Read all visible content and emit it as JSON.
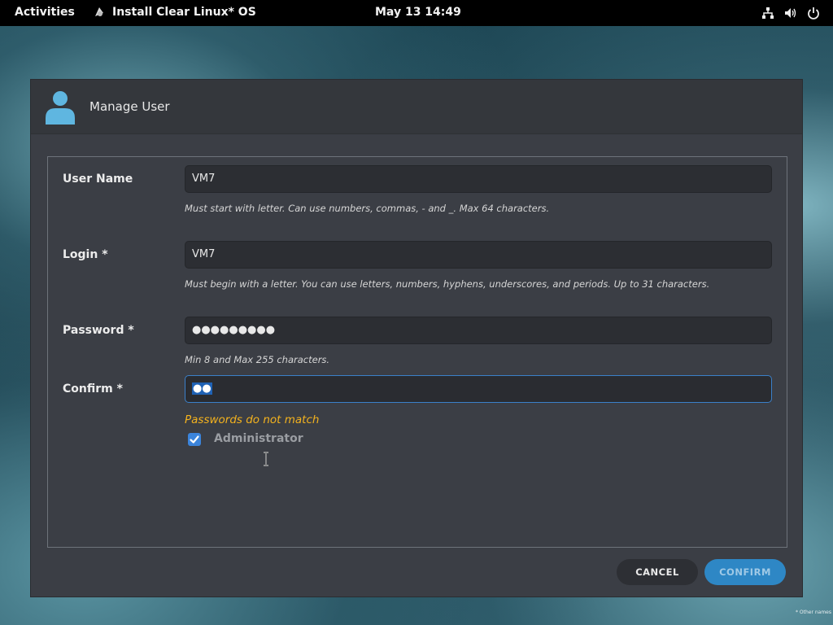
{
  "topbar": {
    "activities": "Activities",
    "app_title": "Install Clear Linux* OS",
    "clock": "May 13  14:49"
  },
  "dialog": {
    "title": "Manage User",
    "fields": {
      "username": {
        "label": "User Name",
        "value": "VM7",
        "hint": "Must start with letter. Can use numbers, commas, - and _. Max 64 characters."
      },
      "login": {
        "label": "Login *",
        "value": "VM7",
        "hint": "Must begin with a letter. You can use letters, numbers, hyphens, underscores, and periods. Up to 31 characters."
      },
      "password": {
        "label": "Password *",
        "value": "●●●●●●●●●",
        "hint": "Min 8 and Max 255 characters."
      },
      "confirm": {
        "label": "Confirm *",
        "value": "●●",
        "error": "Passwords do not match"
      }
    },
    "administrator": {
      "label": "Administrator",
      "checked": true
    },
    "buttons": {
      "cancel": "CANCEL",
      "confirm": "CONFIRM"
    }
  },
  "corner_note": "* Other names",
  "colors": {
    "accent": "#2e87c5",
    "error": "#f3b21e",
    "focus_border": "#3b80c9"
  },
  "icons": [
    "app-icon",
    "network-icon",
    "volume-icon",
    "power-icon",
    "user-icon",
    "check-icon",
    "ibeam-cursor-icon"
  ]
}
